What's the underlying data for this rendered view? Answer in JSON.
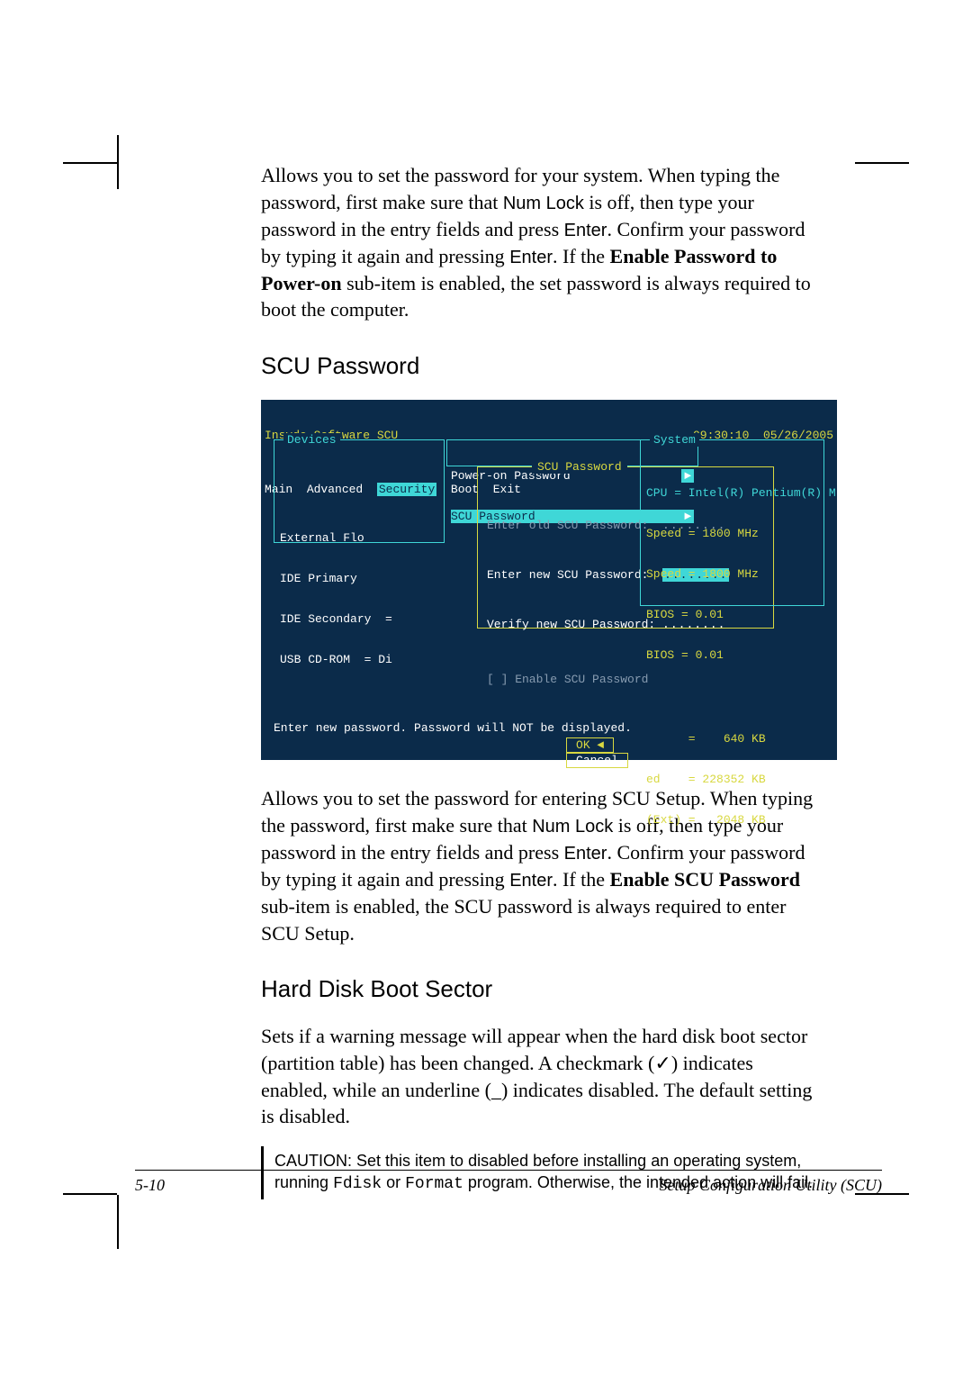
{
  "body": {
    "para1_a": "Allows you to set the password for your system. When typing the password, first make sure that ",
    "numlock": "Num Lock",
    "para1_b": " is off, then type your password in the entry fields and press ",
    "enter": "Enter",
    "para1_c": ". Confirm your password by typing it again and pressing ",
    "para1_d": ". If the ",
    "bold1": "Enable Password to Power-on",
    "para1_e": " sub-item is enabled, the set password is always required to boot the computer.",
    "h_scu": "SCU Password",
    "para2_a": "Allows you to set the password for entering SCU Setup. When typing the password, first make sure that ",
    "para2_b": " is off, then type your password in the entry fields and press ",
    "para2_c": ". Confirm your password by typing it again and pressing ",
    "para2_d": ". If the ",
    "bold2": "Enable SCU Password",
    "para2_e": " sub-item is enabled, the SCU password is always required to enter SCU Setup.",
    "h_hd": "Hard Disk Boot Sector",
    "para3": "Sets if a warning message will appear when the hard disk boot sector (partition table) has been changed. A checkmark (✓) indicates enabled, while an underline (_) indicates disabled. The default setting is disabled.",
    "caution_a": "CAUTION: ",
    "caution_b": "Set this item to disabled before installing an operating system, running ",
    "caution_c1": "Fdisk",
    "caution_d": " or ",
    "caution_c2": "Format",
    "caution_e": " program. Otherwise, the intended action will fail."
  },
  "bios": {
    "title_left": "Insyde Software SCU",
    "title_right": "09:30:10  05/26/2005",
    "menu": {
      "main": "Main",
      "adv": "Advanced",
      "sec": "Security",
      "boot": "Boot",
      "exit": "Exit"
    },
    "devices": {
      "label": "Devices",
      "r1": "External Flo",
      "r2": "IDE Primary",
      "r3": "IDE Secondary  =",
      "r4": "USB CD-ROM  = Di"
    },
    "secmenu": {
      "i1": "Power-on Password",
      "i2": "SCU Password",
      "arrow": "►"
    },
    "dialog": {
      "title": "SCU Password",
      "l1": "Enter old SCU Password:",
      "l2": "Enter new SCU Password:",
      "l3": "Verify new SCU Password:",
      "chk": "[ ] Enable SCU Password",
      "ok": "OK",
      "cancel": "Cancel",
      "dots": "........"
    },
    "system": {
      "label": "System",
      "l1": "CPU = Intel(R) Pentium(R) M",
      "l2": "Speed = 1800 MHz",
      "l3": "Speed = 1800 MHz",
      "l4": "BIOS = 0.01",
      "l5": "BIOS = 0.01",
      "l6": "      =    640 KB",
      "l7": "ed    = 228352 KB",
      "l8": "(Ext) =   2048 KB"
    },
    "hint": "Enter new password. Password will NOT be displayed."
  },
  "footer": {
    "left": "5-10",
    "right": "Setup Configuration Utility (SCU)"
  }
}
